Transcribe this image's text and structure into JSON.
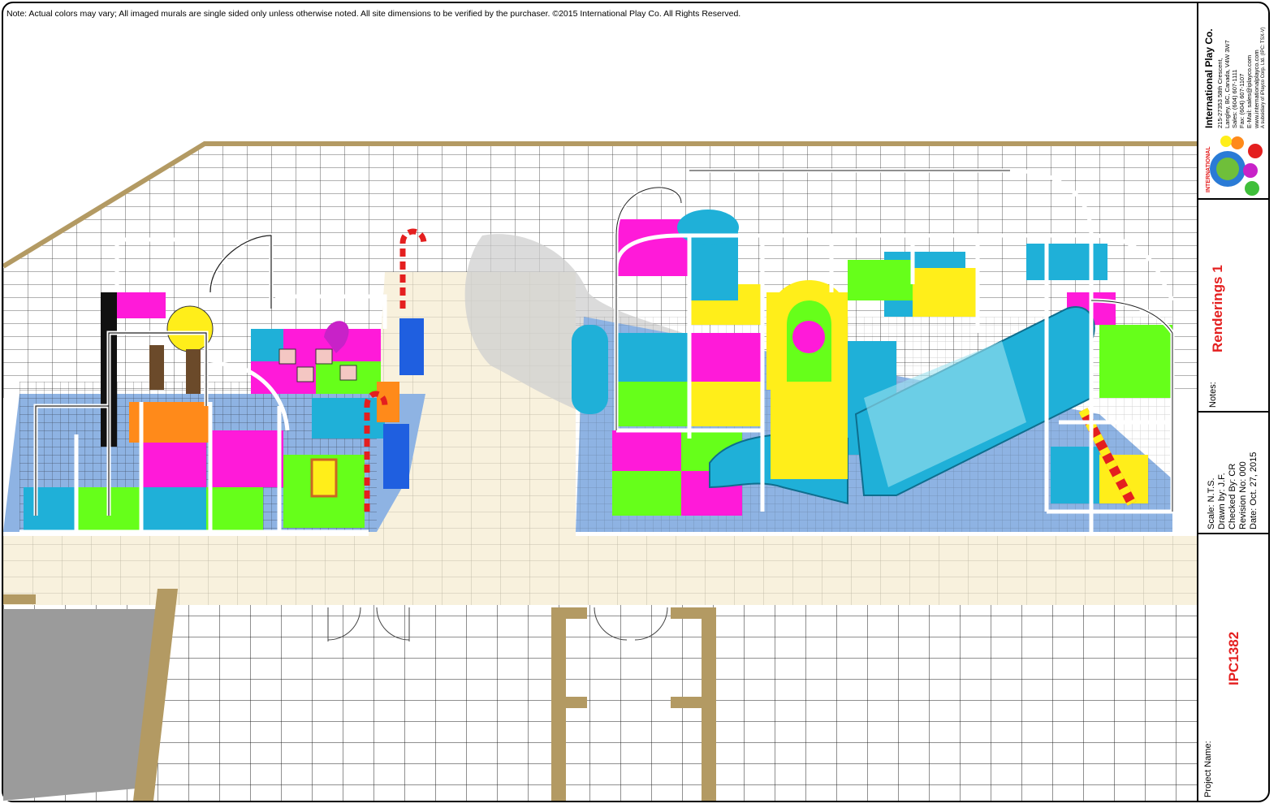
{
  "note": "Note: Actual colors may vary; All imaged murals are single sided only unless otherwise noted.  All site dimensions to be verified by the purchaser. ©2015 International Play Co. All Rights Reserved.",
  "company": {
    "name": "International Play Co.",
    "address1": "215-27353 58th Crescent,",
    "address2": "Langley, BC, Canada, V4W 3W7",
    "sales": "Sales: (604) 607-1111",
    "fax": "Fax: (604) 607-1107",
    "email": "E-Mail: sales@iplayco.com",
    "web": "www.internationalplayco.com",
    "sub": "A subsidiary of iPlayco Corp. Ltd. (IPC: TSX-V)",
    "logo_text": "INTERNATIONAL"
  },
  "sheet": {
    "title": "Renderings 1",
    "notes_label": "Notes:",
    "scale": "Scale: N.T.S.",
    "drawn_by": "Drawn by: J.F.",
    "checked_by": "Checked By: CR",
    "revision": "Revision No: 000",
    "date": "Date: Oct. 27, 2015",
    "project_label": "Project Name:",
    "project_code": "IPC1382"
  },
  "colors": {
    "accent_red": "#e41f1f",
    "floor_tan": "#b39a63",
    "pad_blue": "#8eb3e3",
    "carpet": "#f7f0dc",
    "magenta": "#ff1ad9",
    "lime": "#66ff1a",
    "cyan": "#1fb0d8",
    "yellow": "#ffee1a",
    "orange": "#ff8a1a"
  }
}
